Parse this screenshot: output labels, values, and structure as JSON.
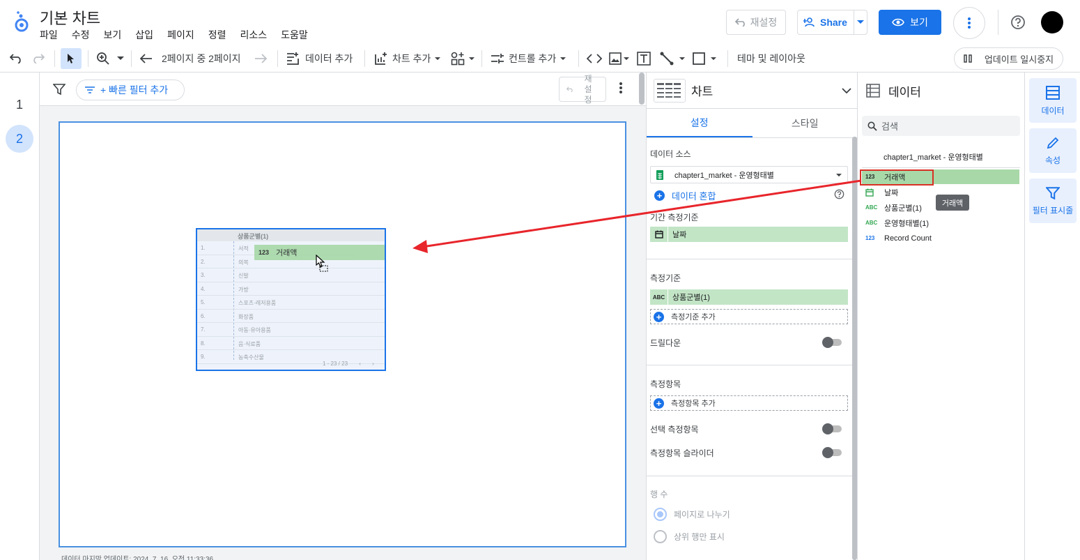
{
  "header": {
    "title": "기본 차트",
    "menu": [
      "파일",
      "수정",
      "보기",
      "삽입",
      "페이지",
      "정렬",
      "리소스",
      "도움말"
    ],
    "undo_label": "재설정",
    "share_label": "Share",
    "view_label": "보기"
  },
  "toolbar": {
    "page_indicator": "2페이지 중 2페이지",
    "add_data": "데이터 추가",
    "add_chart": "차트 추가",
    "add_control": "컨트롤 추가",
    "theme_layout": "테마 및 레이아웃",
    "pause_updates": "업데이트 일시중지"
  },
  "pages": [
    "1",
    "2"
  ],
  "canvas": {
    "quick_filter": "+ 빠른 필터 추가",
    "reset_label": "재설정",
    "last_update": "데이터 마지막 업데이트: 2024. 7. 16. 오전 11:33:36",
    "table": {
      "header": "상품군별(1)",
      "rows": [
        {
          "idx": "1.",
          "val": "서적"
        },
        {
          "idx": "2.",
          "val": "의복"
        },
        {
          "idx": "3.",
          "val": "신발"
        },
        {
          "idx": "4.",
          "val": "가방"
        },
        {
          "idx": "5.",
          "val": "스포츠·레저용품"
        },
        {
          "idx": "6.",
          "val": "화장품"
        },
        {
          "idx": "7.",
          "val": "아동·유아용품"
        },
        {
          "idx": "8.",
          "val": "음·식료품"
        },
        {
          "idx": "9.",
          "val": "농축수산물"
        }
      ],
      "footer": "1 - 23 / 23",
      "drop_chip_type": "123",
      "drop_chip_label": "거래액"
    }
  },
  "chart_panel": {
    "title": "차트",
    "tabs": [
      "설정",
      "스타일"
    ],
    "data_source_label": "데이터 소스",
    "data_source_value": "chapter1_market - 운영형태별",
    "blend_label": "데이터 혼합",
    "date_range_label": "기간 측정기준",
    "date_range_field": "날짜",
    "dimension_label": "측정기준",
    "dimension_field_type": "ABC",
    "dimension_field": "상품군별(1)",
    "add_dimension": "측정기준 추가",
    "drilldown": "드릴다운",
    "metric_label": "측정항목",
    "add_metric": "측정항목 추가",
    "optional_metrics": "선택 측정항목",
    "metric_slider": "측정항목 슬라이더",
    "rows_label": "행 수",
    "paginate": "페이지로 나누기",
    "top_rows": "상위 행만 표시"
  },
  "data_panel": {
    "title": "데이터",
    "search_placeholder": "검색",
    "source": "chapter1_market - 운영형태별",
    "fields": [
      {
        "type": "123",
        "name": "거래액"
      },
      {
        "type": "date",
        "name": "날짜"
      },
      {
        "type": "ABC",
        "name": "상품군별(1)"
      },
      {
        "type": "ABC",
        "name": "운영형태별(1)"
      },
      {
        "type": "123",
        "name": "Record Count"
      }
    ],
    "tooltip": "거래액"
  },
  "rail": {
    "data": "데이터",
    "properties": "속성",
    "filter": "필터 표시줄"
  },
  "colors": {
    "accent": "#1a73e8",
    "field_green": "#a8d8a8",
    "highlight_red": "#d93025"
  }
}
